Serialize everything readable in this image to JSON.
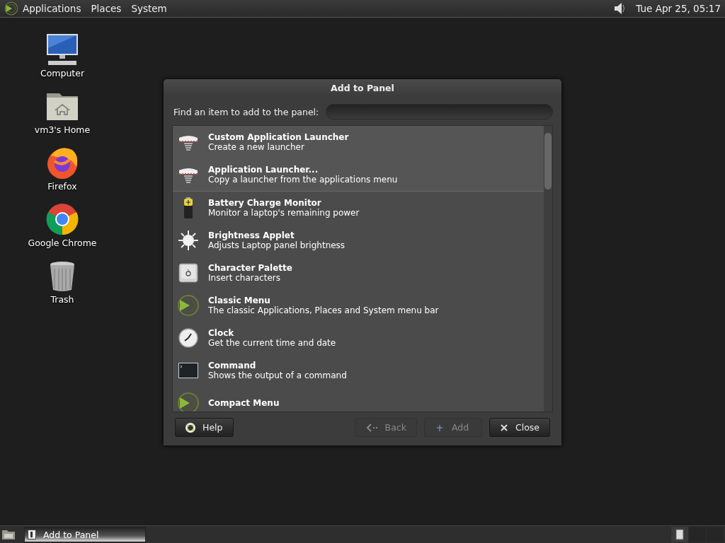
{
  "top_panel": {
    "menus": [
      "Applications",
      "Places",
      "System"
    ],
    "clock": "Tue Apr 25, 05:17"
  },
  "desktop_icons": [
    {
      "kind": "computer",
      "label": "Computer"
    },
    {
      "kind": "home",
      "label": "vm3's Home"
    },
    {
      "kind": "firefox",
      "label": "Firefox"
    },
    {
      "kind": "chrome",
      "label": "Google Chrome"
    },
    {
      "kind": "trash",
      "label": "Trash"
    }
  ],
  "dialog": {
    "title": "Add to Panel",
    "search_label": "Find an item to add to the panel:",
    "sections": [
      {
        "items": [
          {
            "kind": "launcher",
            "name": "Custom Application Launcher",
            "description": "Create a new launcher"
          },
          {
            "kind": "launcher",
            "name": "Application Launcher...",
            "description": "Copy a launcher from the applications menu"
          }
        ]
      },
      {
        "items": [
          {
            "kind": "battery",
            "name": "Battery Charge Monitor",
            "description": "Monitor a laptop's remaining power"
          },
          {
            "kind": "brightness",
            "name": "Brightness Applet",
            "description": "Adjusts Laptop panel brightness"
          },
          {
            "kind": "character",
            "name": "Character Palette",
            "description": "Insert characters"
          },
          {
            "kind": "menu",
            "name": "Classic Menu",
            "description": "The classic Applications, Places and System menu bar"
          },
          {
            "kind": "clock",
            "name": "Clock",
            "description": "Get the current time and date"
          },
          {
            "kind": "terminal",
            "name": "Command",
            "description": "Shows the output of a command"
          },
          {
            "kind": "menu",
            "name": "Compact Menu"
          }
        ]
      }
    ],
    "buttons": [
      {
        "kind": "help",
        "label": "Help",
        "disabled": false
      },
      {
        "kind": "back",
        "label": "Back",
        "disabled": true
      },
      {
        "kind": "add",
        "label": "Add",
        "disabled": true
      },
      {
        "kind": "close",
        "label": "Close",
        "disabled": false
      }
    ]
  },
  "taskbar": {
    "tasks": [
      {
        "label": "Add to Panel",
        "selected": true
      }
    ]
  }
}
